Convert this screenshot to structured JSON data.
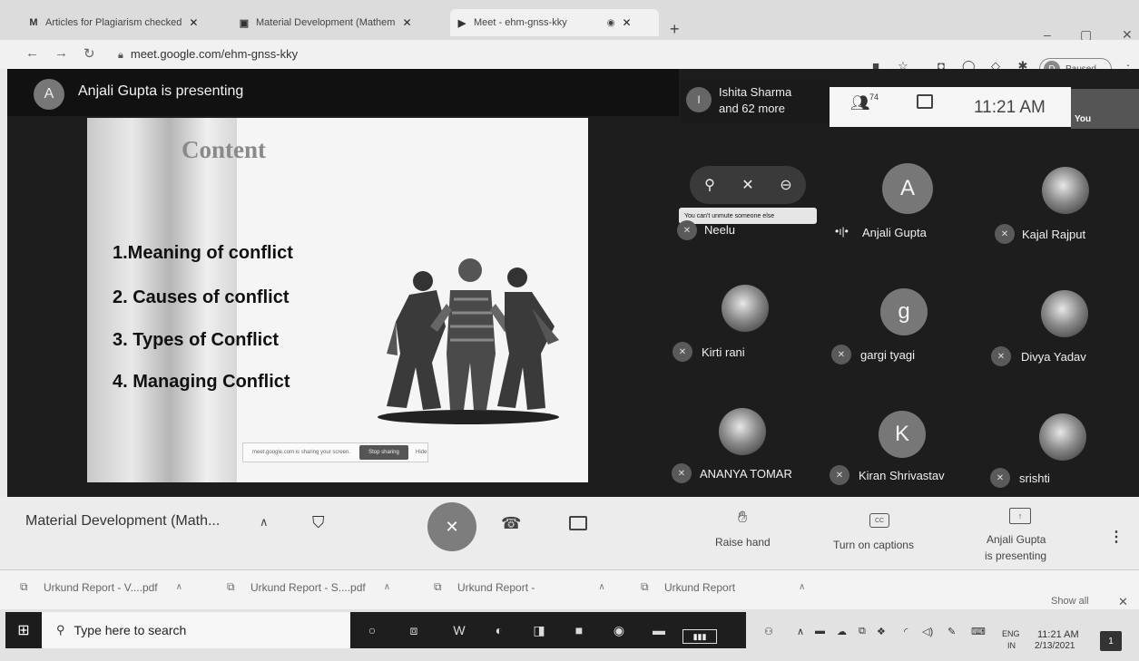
{
  "browser": {
    "tabs": [
      {
        "icon": "M",
        "label": "Articles for Plagiarism checked"
      },
      {
        "icon": "▣",
        "label": "Material Development (Mathem"
      },
      {
        "icon": "▶",
        "label": "Meet - ehm-gnss-kky"
      }
    ],
    "url": "meet.google.com/ehm-gnss-kky",
    "profile_status": "Paused",
    "profile_initial": "D"
  },
  "meet": {
    "presenter": {
      "initial": "A",
      "text": "Anjali Gupta is presenting"
    },
    "slide": {
      "title": "Content",
      "items": [
        "1.Meaning of  conflict",
        "2. Causes of conflict",
        "3. Types of Conflict",
        "4. Managing Conflict"
      ],
      "share_bar_text": "meet.google.com is sharing your screen.",
      "stop_sharing_label": "Stop sharing",
      "hide_label": "Hide"
    },
    "pinned": {
      "initial": "I",
      "name": "Ishita Sharma",
      "more": "and 62 more"
    },
    "participants_count": "74",
    "time": "11:21 AM",
    "you_label": "You",
    "tooltip": "You can't unmute someone else",
    "tiles": [
      {
        "name": "Neelu",
        "avatar": "",
        "kind": "none",
        "muted": true
      },
      {
        "name": "Anjali Gupta",
        "avatar": "A",
        "kind": "letter",
        "muted": false
      },
      {
        "name": "Kajal Rajput",
        "avatar": "",
        "kind": "photo",
        "muted": true
      },
      {
        "name": "Kirti rani",
        "avatar": "",
        "kind": "photo",
        "muted": true
      },
      {
        "name": "gargi tyagi",
        "avatar": "g",
        "kind": "letter",
        "muted": true
      },
      {
        "name": "Divya Yadav",
        "avatar": "",
        "kind": "photo",
        "muted": true
      },
      {
        "name": "ANANYA TOMAR",
        "avatar": "",
        "kind": "photo",
        "muted": true
      },
      {
        "name": "Kiran Shrivastav",
        "avatar": "K",
        "kind": "letter",
        "muted": true
      },
      {
        "name": "srishti",
        "avatar": "",
        "kind": "photo",
        "muted": true
      }
    ]
  },
  "controls": {
    "meeting_title": "Material Development (Math...",
    "raise_hand": "Raise hand",
    "captions": "Turn on captions",
    "presenting_line1": "Anjali Gupta",
    "presenting_line2": "is presenting"
  },
  "downloads": {
    "items": [
      "Urkund Report - V....pdf",
      "Urkund Report - S....pdf",
      "Urkund Report -",
      "Urkund Report"
    ],
    "show_all": "Show all"
  },
  "taskbar": {
    "search_placeholder": "Type here to search",
    "lang": "ENG",
    "region": "IN",
    "time": "11:21 AM",
    "date": "2/13/2021",
    "notifications": "1"
  }
}
